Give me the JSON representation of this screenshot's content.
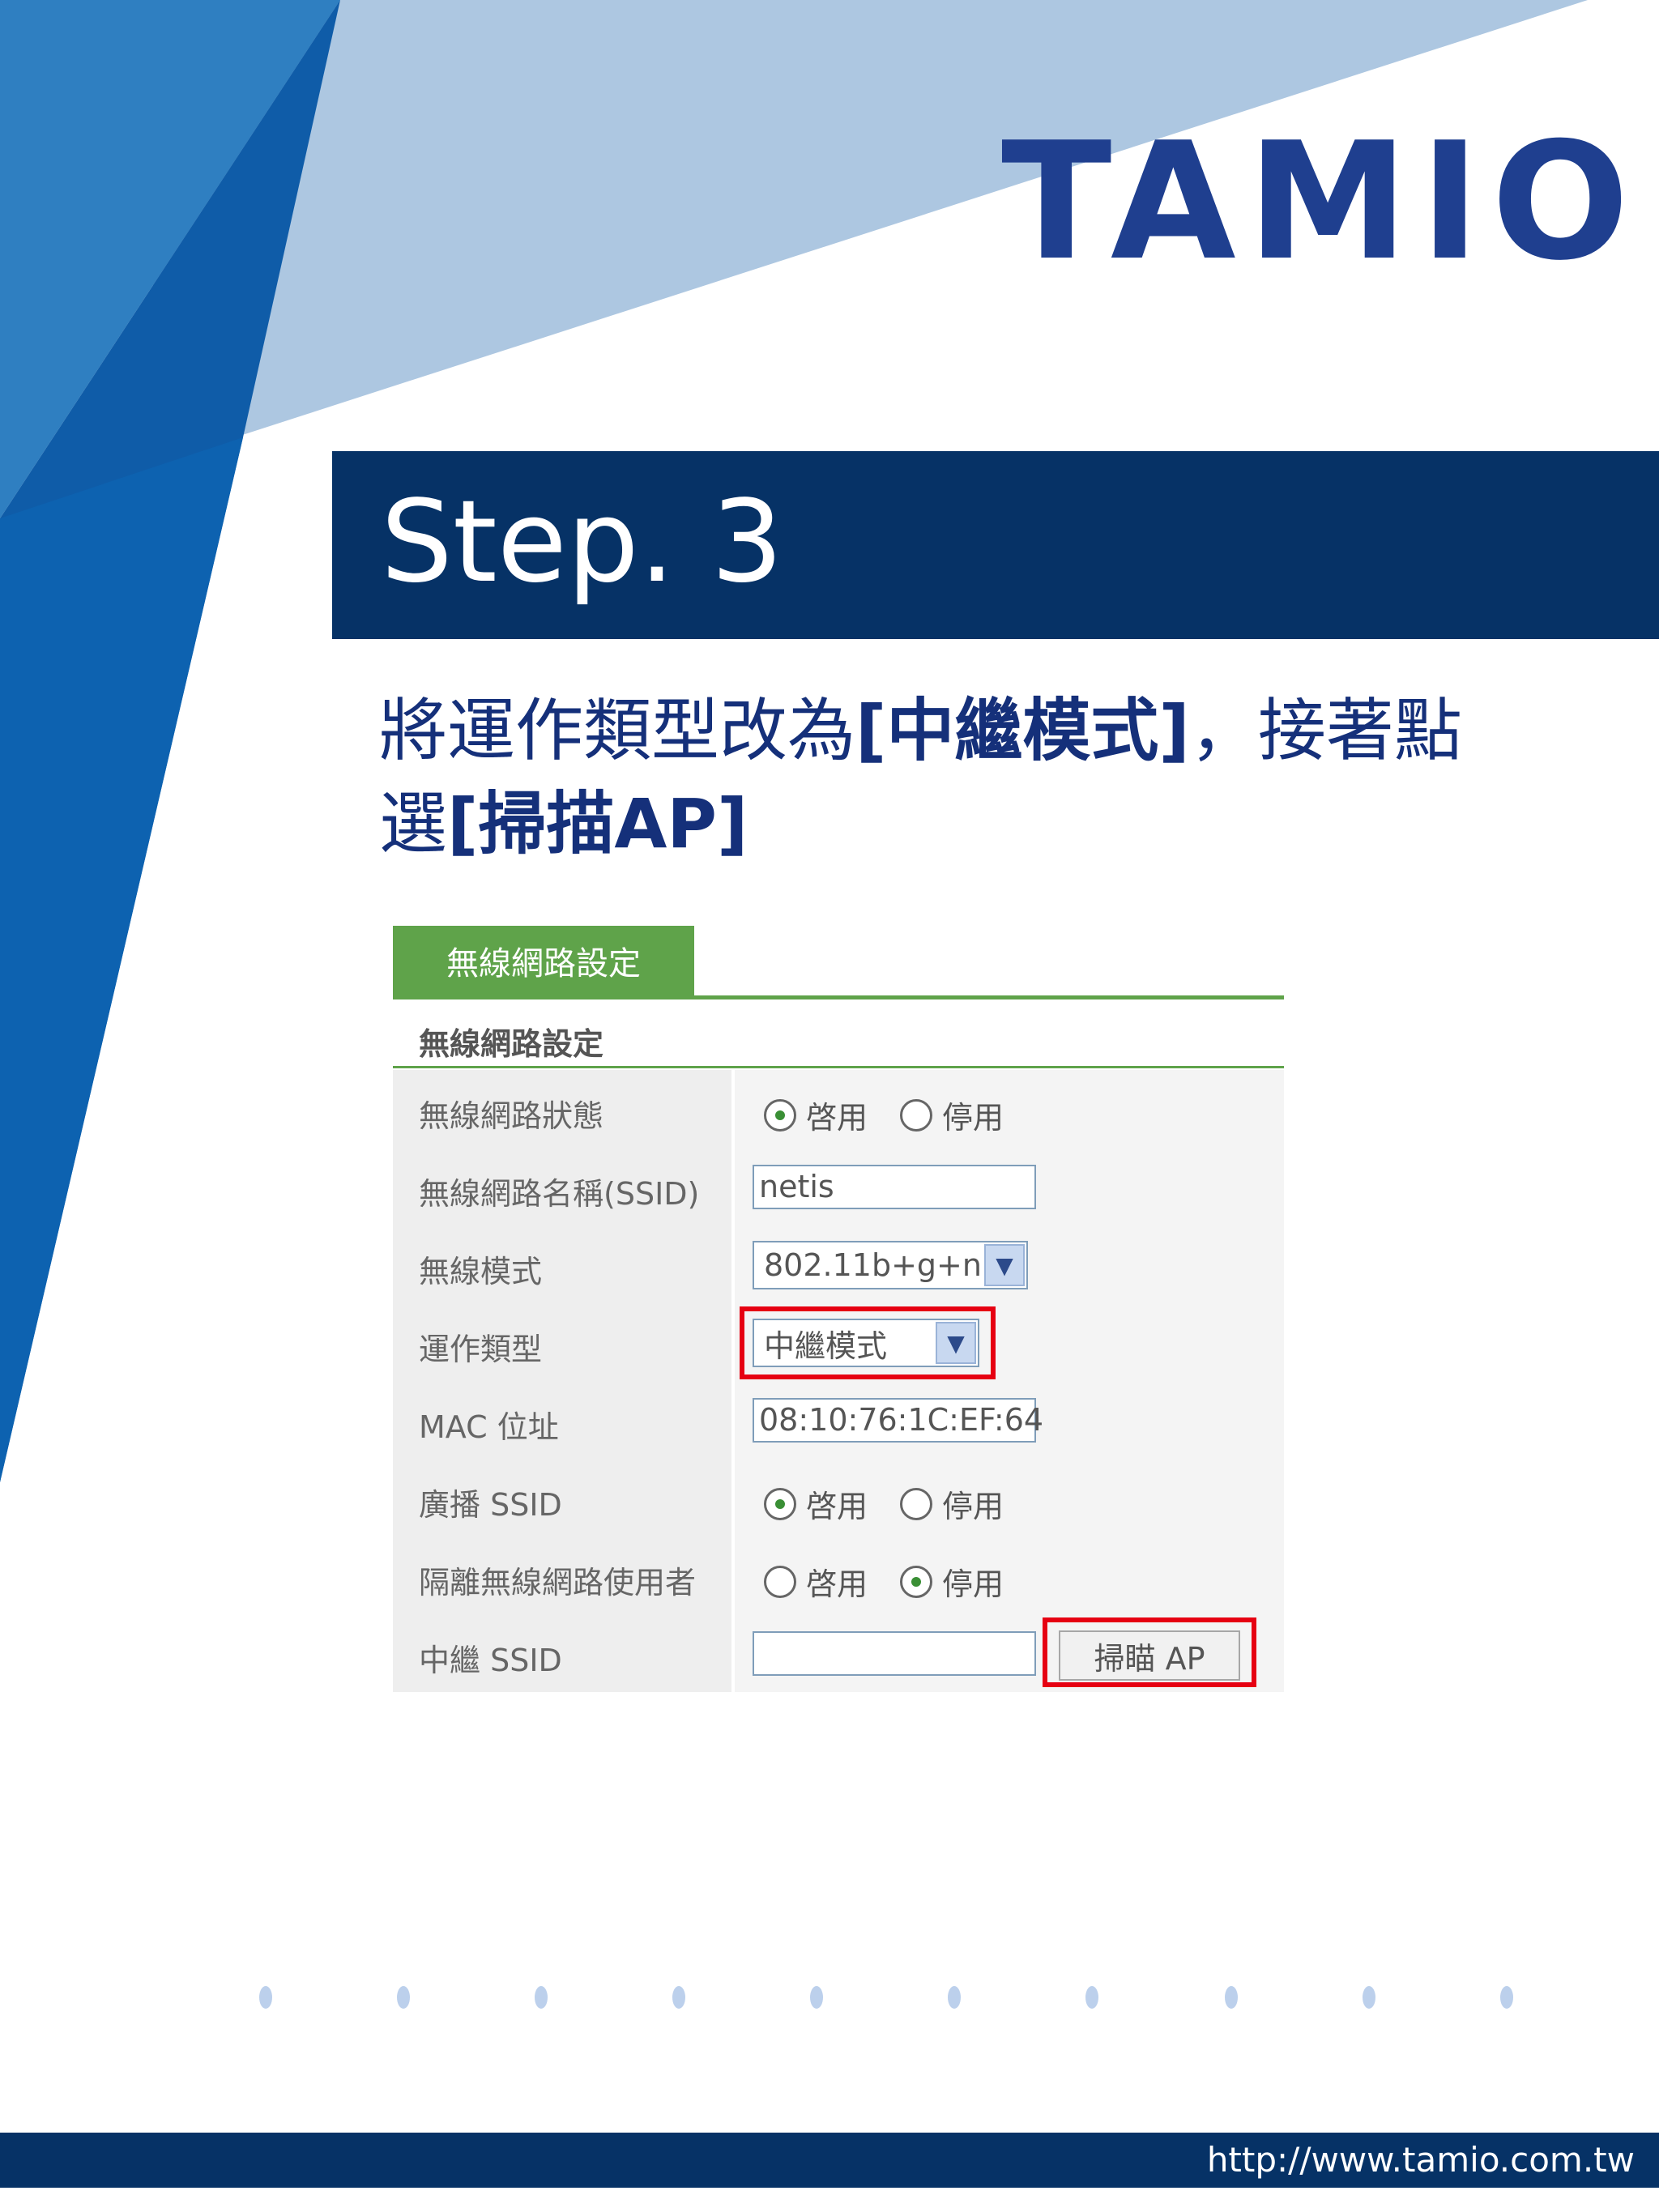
{
  "brand": {
    "logo_text": "TAMIO"
  },
  "step": {
    "title": "Step. 3"
  },
  "instruction": {
    "line1_pre": "將運作類型改為",
    "line1_bold": "[中繼模式]",
    "line1_post": "，接著點",
    "line2_pre": "選",
    "line2_bold": "[掃描AP]"
  },
  "panel": {
    "tab_label": "無線網路設定",
    "header_title": "無線網路設定",
    "rows": {
      "status": {
        "label": "無線網路狀態",
        "opt_on": "啓用",
        "opt_off": "停用",
        "selected": "on"
      },
      "ssid": {
        "label": "無線網路名稱(SSID)",
        "value": "netis"
      },
      "mode": {
        "label": "無線模式",
        "value": "802.11b+g+n"
      },
      "op_type": {
        "label": "運作類型",
        "value": "中繼模式"
      },
      "mac": {
        "label": "MAC 位址",
        "value": "08:10:76:1C:EF:64"
      },
      "broadcast": {
        "label": "廣播 SSID",
        "opt_on": "啓用",
        "opt_off": "停用",
        "selected": "on"
      },
      "isolate": {
        "label": "隔離無線網路使用者",
        "opt_on": "啓用",
        "opt_off": "停用",
        "selected": "off"
      },
      "relay_ssid": {
        "label": "中繼 SSID",
        "value": "",
        "button": "掃瞄 AP"
      }
    }
  },
  "icons": {
    "dropdown": "chevron-down-icon",
    "radio": "radio-icon"
  },
  "colors": {
    "brand_blue": "#1f3f8f",
    "navy_bar": "#063266",
    "panel_green": "#5fa34a",
    "highlight_red": "#e60012"
  },
  "footer": {
    "url": "http://www.tamio.com.tw"
  }
}
